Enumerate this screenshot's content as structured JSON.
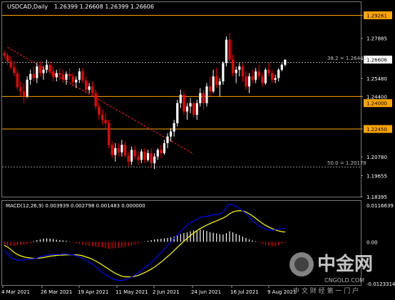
{
  "header": {
    "symbol_tf": "USDCAD,Daily",
    "ohlc": "1.26399 1.26608 1.26399 1.26606"
  },
  "macd": {
    "label": "MACD(12,26,9) 0.003939 0.002798 0.001483 0.000000",
    "axis_labels": [
      "0.0116639",
      "0.00",
      "-0.0123314"
    ]
  },
  "price_axis": {
    "labels": [
      "1.29261",
      "1.27885",
      "1.26606",
      "1.25480",
      "1.24400",
      "1.22450",
      "1.20780",
      "1.19655",
      "1.18395"
    ],
    "highlighted": [
      "1.29261",
      "1.24000",
      "1.22450"
    ],
    "current": "1.26606"
  },
  "time_axis": [
    "4 Mar 2021",
    "26 Mar 2021",
    "19 Apr 2021",
    "11 May 2021",
    "2 Jun 2021",
    "24 Jun 2021",
    "16 Jul 2021",
    "9 Aug 2021"
  ],
  "annotations": {
    "fib_382": "38.2 = 1.26440",
    "fib_500": "50.0 = 1.20178"
  },
  "watermark": {
    "brand": "中金网",
    "domain": "CNGOLD.COM",
    "slogan": "中 文 财 经 第 一 门 户"
  },
  "colors": {
    "background": "#000000",
    "bull_candle": "#ffffff",
    "bear_candle": "#ff0000",
    "level_line": "#ffa500",
    "macd_hist_pos": "#ffffff",
    "macd_hist_neg": "#ff0000",
    "macd_line": "#0000ff",
    "signal_line": "#ffff00"
  },
  "chart_data": {
    "type": "candlestick",
    "title": "USDCAD,Daily",
    "ylim": [
      1.18395,
      1.3005
    ],
    "levels": [
      1.29261,
      1.244,
      1.2245
    ],
    "fib_levels": [
      {
        "label": "38.2",
        "value": 1.2644
      },
      {
        "label": "50.0",
        "value": 1.20178
      }
    ],
    "trendline": [
      [
        1.2734,
        1.2095
      ]
    ],
    "candles": [
      [
        1.27,
        1.2715,
        1.2665,
        1.2685
      ],
      [
        1.2685,
        1.27,
        1.263,
        1.265
      ],
      [
        1.265,
        1.268,
        1.26,
        1.2615
      ],
      [
        1.2615,
        1.265,
        1.256,
        1.258
      ],
      [
        1.258,
        1.26,
        1.248,
        1.2495
      ],
      [
        1.2495,
        1.253,
        1.244,
        1.247
      ],
      [
        1.247,
        1.252,
        1.24,
        1.244
      ],
      [
        1.244,
        1.256,
        1.243,
        1.254
      ],
      [
        1.254,
        1.26,
        1.251,
        1.2575
      ],
      [
        1.2575,
        1.262,
        1.253,
        1.255
      ],
      [
        1.255,
        1.264,
        1.252,
        1.262
      ],
      [
        1.262,
        1.265,
        1.256,
        1.258
      ],
      [
        1.258,
        1.262,
        1.254,
        1.26
      ],
      [
        1.26,
        1.266,
        1.258,
        1.263
      ],
      [
        1.263,
        1.265,
        1.257,
        1.259
      ],
      [
        1.259,
        1.262,
        1.253,
        1.2555
      ],
      [
        1.2555,
        1.26,
        1.253,
        1.258
      ],
      [
        1.258,
        1.261,
        1.254,
        1.257
      ],
      [
        1.257,
        1.26,
        1.252,
        1.254
      ],
      [
        1.254,
        1.259,
        1.251,
        1.2575
      ],
      [
        1.2575,
        1.261,
        1.254,
        1.256
      ],
      [
        1.256,
        1.258,
        1.25,
        1.2525
      ],
      [
        1.2525,
        1.256,
        1.249,
        1.254
      ],
      [
        1.254,
        1.261,
        1.252,
        1.259
      ],
      [
        1.259,
        1.261,
        1.252,
        1.2535
      ],
      [
        1.2535,
        1.256,
        1.246,
        1.248
      ],
      [
        1.248,
        1.252,
        1.246,
        1.25
      ],
      [
        1.25,
        1.253,
        1.244,
        1.246
      ],
      [
        1.246,
        1.248,
        1.236,
        1.238
      ],
      [
        1.238,
        1.24,
        1.23,
        1.233
      ],
      [
        1.233,
        1.236,
        1.227,
        1.23
      ],
      [
        1.23,
        1.234,
        1.224,
        1.228
      ],
      [
        1.228,
        1.23,
        1.213,
        1.215
      ],
      [
        1.215,
        1.217,
        1.207,
        1.209
      ],
      [
        1.209,
        1.216,
        1.205,
        1.213
      ],
      [
        1.213,
        1.216,
        1.208,
        1.2105
      ],
      [
        1.2105,
        1.218,
        1.208,
        1.215
      ],
      [
        1.215,
        1.217,
        1.207,
        1.2085
      ],
      [
        1.2085,
        1.211,
        1.202,
        1.205
      ],
      [
        1.205,
        1.214,
        1.203,
        1.212
      ],
      [
        1.212,
        1.2145,
        1.206,
        1.208
      ],
      [
        1.208,
        1.211,
        1.203,
        1.206
      ],
      [
        1.206,
        1.2125,
        1.204,
        1.211
      ],
      [
        1.211,
        1.213,
        1.204,
        1.206
      ],
      [
        1.206,
        1.212,
        1.205,
        1.21
      ],
      [
        1.21,
        1.213,
        1.201,
        1.204
      ],
      [
        1.204,
        1.21,
        1.2005,
        1.208
      ],
      [
        1.208,
        1.213,
        1.206,
        1.212
      ],
      [
        1.212,
        1.215,
        1.207,
        1.21
      ],
      [
        1.21,
        1.218,
        1.209,
        1.216
      ],
      [
        1.216,
        1.222,
        1.213,
        1.22
      ],
      [
        1.22,
        1.225,
        1.217,
        1.223
      ],
      [
        1.223,
        1.23,
        1.22,
        1.228
      ],
      [
        1.228,
        1.242,
        1.226,
        1.24
      ],
      [
        1.24,
        1.248,
        1.237,
        1.245
      ],
      [
        1.245,
        1.247,
        1.233,
        1.235
      ],
      [
        1.235,
        1.24,
        1.23,
        1.238
      ],
      [
        1.238,
        1.243,
        1.234,
        1.24
      ],
      [
        1.24,
        1.241,
        1.231,
        1.233
      ],
      [
        1.233,
        1.242,
        1.23,
        1.24
      ],
      [
        1.24,
        1.249,
        1.238,
        1.246
      ],
      [
        1.246,
        1.248,
        1.236,
        1.24
      ],
      [
        1.24,
        1.252,
        1.238,
        1.25
      ],
      [
        1.25,
        1.256,
        1.244,
        1.247
      ],
      [
        1.247,
        1.26,
        1.246,
        1.256
      ],
      [
        1.256,
        1.261,
        1.249,
        1.251
      ],
      [
        1.251,
        1.255,
        1.244,
        1.253
      ],
      [
        1.253,
        1.265,
        1.251,
        1.264
      ],
      [
        1.264,
        1.28,
        1.262,
        1.278
      ],
      [
        1.278,
        1.282,
        1.264,
        1.266
      ],
      [
        1.266,
        1.269,
        1.256,
        1.258
      ],
      [
        1.258,
        1.262,
        1.252,
        1.26
      ],
      [
        1.26,
        1.264,
        1.256,
        1.262
      ],
      [
        1.262,
        1.264,
        1.253,
        1.256
      ],
      [
        1.256,
        1.259,
        1.248,
        1.25
      ],
      [
        1.25,
        1.258,
        1.246,
        1.256
      ],
      [
        1.256,
        1.26,
        1.252,
        1.254
      ],
      [
        1.254,
        1.261,
        1.252,
        1.259
      ],
      [
        1.259,
        1.263,
        1.254,
        1.256
      ],
      [
        1.256,
        1.258,
        1.25,
        1.252
      ],
      [
        1.252,
        1.261,
        1.251,
        1.26
      ],
      [
        1.26,
        1.264,
        1.256,
        1.258
      ],
      [
        1.258,
        1.26,
        1.252,
        1.254
      ],
      [
        1.254,
        1.257,
        1.252,
        1.255
      ],
      [
        1.255,
        1.261,
        1.253,
        1.26
      ],
      [
        1.26,
        1.264,
        1.259,
        1.263
      ],
      [
        1.263,
        1.2662,
        1.262,
        1.26606
      ]
    ],
    "macd_hist": [
      -0.0008,
      -0.001,
      -0.0011,
      -0.0012,
      -0.001,
      -0.0009,
      -0.0008,
      -0.0006,
      -0.0004,
      0.0002,
      0.0005,
      0.0007,
      0.0009,
      0.001,
      0.0009,
      0.0008,
      0.0006,
      0.0005,
      0.0004,
      0.0003,
      0.0001,
      -0.0002,
      -0.0004,
      -0.0006,
      -0.0008,
      -0.001,
      -0.0012,
      -0.0013,
      -0.0014,
      -0.0015,
      -0.0016,
      -0.0018,
      -0.002,
      -0.0019,
      -0.0018,
      -0.0017,
      -0.0016,
      -0.0014,
      -0.0012,
      -0.001,
      -0.0008,
      -0.0005,
      -0.0002,
      0.0001,
      0.0003,
      0.0005,
      0.0007,
      0.0008,
      0.0009,
      0.001,
      0.0011,
      0.0013,
      0.0015,
      0.0018,
      0.0022,
      0.0025,
      0.0027,
      0.003,
      0.0032,
      0.0033,
      0.0035,
      0.0033,
      0.0031,
      0.0028,
      0.0026,
      0.0024,
      0.0022,
      0.0021,
      0.0025,
      0.003,
      0.0027,
      0.0023,
      0.0019,
      0.0015,
      0.0011,
      0.0007,
      0.0004,
      0.0002,
      -0.0002,
      -0.0006,
      -0.0009,
      -0.0011,
      -0.0013,
      -0.0012,
      -0.001,
      -0.0006,
      -0.0003
    ],
    "macd_line": [
      -0.0025,
      -0.0035,
      -0.0045,
      -0.005,
      -0.0052,
      -0.0053,
      -0.0052,
      -0.005,
      -0.0049,
      -0.0048,
      -0.0046,
      -0.0043,
      -0.004,
      -0.0038,
      -0.0037,
      -0.0036,
      -0.0036,
      -0.0036,
      -0.0035,
      -0.0035,
      -0.0036,
      -0.0037,
      -0.004,
      -0.0043,
      -0.0048,
      -0.0053,
      -0.0058,
      -0.0064,
      -0.0072,
      -0.008,
      -0.0088,
      -0.0094,
      -0.01,
      -0.0105,
      -0.0108,
      -0.011,
      -0.011,
      -0.0108,
      -0.0104,
      -0.01,
      -0.0095,
      -0.0088,
      -0.008,
      -0.0074,
      -0.0066,
      -0.0058,
      -0.005,
      -0.004,
      -0.003,
      -0.002,
      -0.001,
      0.0,
      0.001,
      0.002,
      0.003,
      0.004,
      0.0048,
      0.0055,
      0.006,
      0.0065,
      0.007,
      0.0072,
      0.0073,
      0.0075,
      0.0077,
      0.0078,
      0.008,
      0.0085,
      0.01,
      0.0108,
      0.0105,
      0.01,
      0.0095,
      0.0088,
      0.008,
      0.007,
      0.006,
      0.0052,
      0.0045,
      0.004,
      0.0036,
      0.0034,
      0.0033,
      0.0035,
      0.0037,
      0.0038,
      0.0039
    ],
    "signal_line": [
      -0.001,
      -0.0015,
      -0.0022,
      -0.003,
      -0.0036,
      -0.004,
      -0.0043,
      -0.0045,
      -0.0046,
      -0.0047,
      -0.0047,
      -0.0046,
      -0.0045,
      -0.0043,
      -0.0041,
      -0.004,
      -0.0039,
      -0.0038,
      -0.0038,
      -0.0037,
      -0.0037,
      -0.0037,
      -0.0037,
      -0.0038,
      -0.004,
      -0.0043,
      -0.0046,
      -0.005,
      -0.0055,
      -0.006,
      -0.0066,
      -0.0072,
      -0.0078,
      -0.0084,
      -0.009,
      -0.0094,
      -0.0098,
      -0.01,
      -0.01,
      -0.01,
      -0.0098,
      -0.0096,
      -0.0092,
      -0.0088,
      -0.0083,
      -0.0078,
      -0.0072,
      -0.0065,
      -0.0058,
      -0.005,
      -0.0042,
      -0.0034,
      -0.0025,
      -0.0016,
      -0.0007,
      0.0002,
      0.001,
      0.0018,
      0.0025,
      0.0032,
      0.0038,
      0.0043,
      0.0048,
      0.0052,
      0.0056,
      0.006,
      0.0064,
      0.0068,
      0.0073,
      0.008,
      0.0085,
      0.0088,
      0.0089,
      0.0088,
      0.0085,
      0.008,
      0.0074,
      0.0067,
      0.006,
      0.0053,
      0.0047,
      0.0042,
      0.0038,
      0.0034,
      0.0031,
      0.0029,
      0.0028
    ],
    "macd_ylim": [
      -0.0123314,
      0.0116639
    ]
  }
}
